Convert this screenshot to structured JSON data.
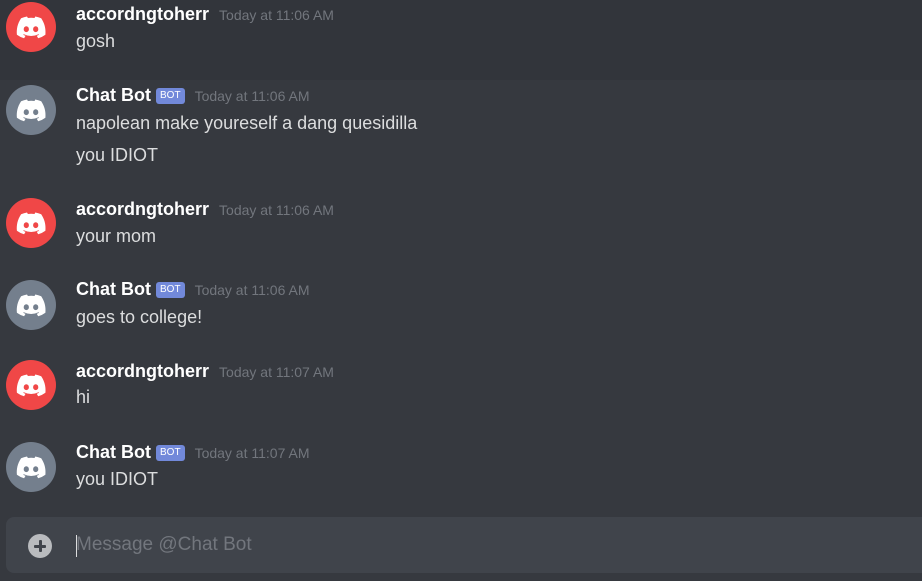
{
  "colors": {
    "user_avatar": "#f04747",
    "bot_avatar": "#747f8d",
    "bot_tag": "#7289da",
    "background": "#36393f"
  },
  "messages": [
    {
      "author": "accordngtoherr",
      "avatar_icon": "discord-logo-icon",
      "timestamp": "Today at 11:06 AM",
      "lines": [
        "gosh"
      ]
    },
    {
      "author": "Chat Bot",
      "bot_tag": "BOT",
      "avatar_icon": "discord-logo-icon",
      "timestamp": "Today at 11:06 AM",
      "lines": [
        "napolean make youreself a dang quesidilla",
        "you IDIOT"
      ]
    },
    {
      "author": "accordngtoherr",
      "avatar_icon": "discord-logo-icon",
      "timestamp": "Today at 11:06 AM",
      "lines": [
        "your mom"
      ]
    },
    {
      "author": "Chat Bot",
      "bot_tag": "BOT",
      "avatar_icon": "discord-logo-icon",
      "timestamp": "Today at 11:06 AM",
      "lines": [
        "goes to college!"
      ]
    },
    {
      "author": "accordngtoherr",
      "avatar_icon": "discord-logo-icon",
      "timestamp": "Today at 11:07 AM",
      "lines": [
        "hi"
      ]
    },
    {
      "author": "Chat Bot",
      "bot_tag": "BOT",
      "avatar_icon": "discord-logo-icon",
      "timestamp": "Today at 11:07 AM",
      "lines": [
        "you IDIOT"
      ]
    }
  ],
  "composer": {
    "placeholder": "Message @Chat Bot",
    "attach_icon": "plus-circle-icon"
  }
}
